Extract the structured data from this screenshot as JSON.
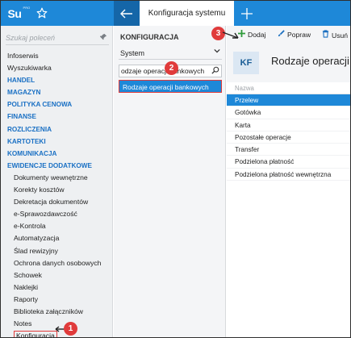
{
  "topbar": {
    "logo_text": "Su",
    "logo_superscript": "PRO",
    "active_tab": "Konfiguracja systemu",
    "accent_color": "#1e88d8"
  },
  "sidebar": {
    "search_placeholder": "Szukaj poleceń",
    "items": [
      {
        "label": "Infoserwis",
        "type": "plain"
      },
      {
        "label": "Wyszukiwarka",
        "type": "plain"
      },
      {
        "label": "HANDEL",
        "type": "head"
      },
      {
        "label": "MAGAZYN",
        "type": "head"
      },
      {
        "label": "POLITYKA CENOWA",
        "type": "head"
      },
      {
        "label": "FINANSE",
        "type": "head"
      },
      {
        "label": "ROZLICZENIA",
        "type": "head"
      },
      {
        "label": "KARTOTEKI",
        "type": "head"
      },
      {
        "label": "KOMUNIKACJA",
        "type": "head"
      },
      {
        "label": "EWIDENCJE DODATKOWE",
        "type": "head"
      },
      {
        "label": "Dokumenty wewnętrzne",
        "type": "sub"
      },
      {
        "label": "Korekty kosztów",
        "type": "sub"
      },
      {
        "label": "Dekretacja dokumentów",
        "type": "sub"
      },
      {
        "label": "e-Sprawozdawczość",
        "type": "sub"
      },
      {
        "label": "e-Kontrola",
        "type": "sub"
      },
      {
        "label": "Automatyzacja",
        "type": "sub"
      },
      {
        "label": "Ślad rewizyjny",
        "type": "sub"
      },
      {
        "label": "Ochrona danych osobowych",
        "type": "sub"
      },
      {
        "label": "Schowek",
        "type": "sub"
      },
      {
        "label": "Naklejki",
        "type": "sub"
      },
      {
        "label": "Raporty",
        "type": "sub"
      },
      {
        "label": "Biblioteka załączników",
        "type": "sub"
      },
      {
        "label": "Notes",
        "type": "sub"
      },
      {
        "label": "Konfiguracja",
        "type": "sub",
        "selected": true
      }
    ]
  },
  "config_panel": {
    "title": "KONFIGURACJA",
    "select_value": "System",
    "filter_value": "odzaje operacji bankowych",
    "result_item": "Rodzaje operacji bankowych"
  },
  "toolbar": {
    "add_label": "Dodaj",
    "edit_label": "Popraw",
    "delete_label": "Usuń"
  },
  "content": {
    "badge": "KF",
    "title": "Rodzaje operacji bankowych",
    "column_header": "Nazwa",
    "rows": [
      "Przelew",
      "Gotówka",
      "Karta",
      "Pozostałe operacje",
      "Transfer",
      "Podzielona płatność",
      "Podzielona płatność wewnętrzna"
    ],
    "selected_row": 0
  },
  "callouts": {
    "one": "1",
    "two": "2",
    "three": "3"
  }
}
